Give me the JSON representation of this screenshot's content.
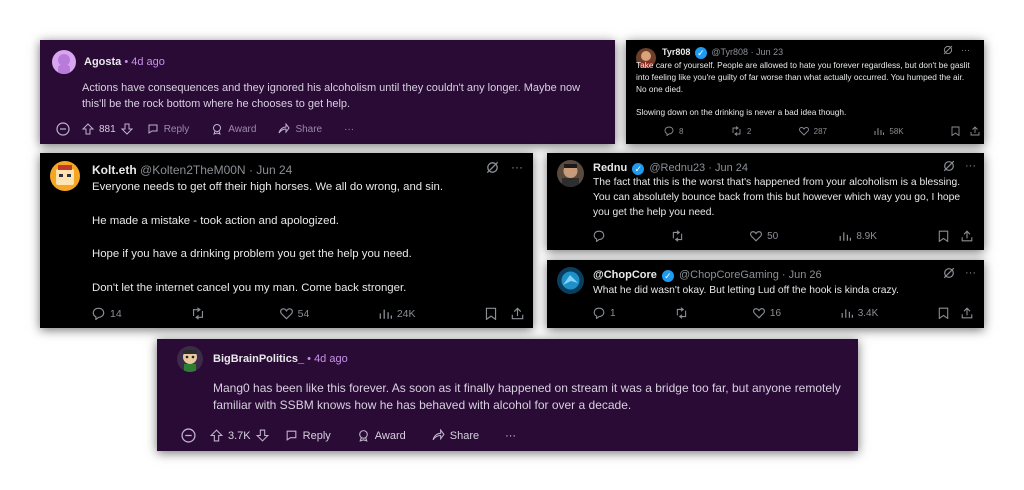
{
  "reddit1": {
    "username": "Agosta",
    "age": "4d ago",
    "text": "Actions have consequences and they ignored his alcoholism until they couldn't any longer. Maybe now this'll be the rock bottom where he chooses to get help.",
    "votes": "881",
    "reply": "Reply",
    "award": "Award",
    "share": "Share",
    "more": "···"
  },
  "tweet1": {
    "name": "Tyr808",
    "handle": "@Tyr808",
    "date": "· Jun 23",
    "text": "Take care of yourself. People are allowed to hate you forever regardless, but don't be gaslit into feeling like you're guilty of far worse than what actually occurred. You humped the air. No one died.\n\nSlowing down on the drinking is never a bad idea though.",
    "replies": "8",
    "retweets": "2",
    "likes": "287",
    "views": "58K"
  },
  "tweet2": {
    "name": "Kolt.eth",
    "handle": "@Kolten2TheM00N",
    "date": "· Jun 24",
    "text": "Everyone needs to get off their high horses. We all do wrong, and sin.\n\nHe made a mistake - took action and apologized.\n\nHope if you have a drinking problem you get the help you need.\n\nDon't let the internet cancel you my man. Come back stronger.",
    "replies": "14",
    "retweets": "",
    "likes": "54",
    "views": "24K"
  },
  "tweet3": {
    "name": "Rednu",
    "handle": "@Rednu23",
    "date": "· Jun 24",
    "text": "The fact that this is the worst that's happened from your alcoholism is a blessing. You can absolutely bounce back from this but however which way you go, I hope you get the help you need.",
    "replies": "",
    "retweets": "",
    "likes": "50",
    "views": "8.9K"
  },
  "tweet4": {
    "name": "@ChopCore",
    "handle": "@ChopCoreGaming",
    "date": "· Jun 26",
    "text": "What he did wasn't okay. But letting Lud off the hook is kinda crazy.",
    "replies": "1",
    "retweets": "",
    "likes": "16",
    "views": "3.4K"
  },
  "reddit2": {
    "username": "BigBrainPolitics_",
    "age": "4d ago",
    "text": "Mang0 has been like this forever. As soon as it finally happened on stream it was a bridge too far, but anyone remotely familiar with SSBM knows how he has behaved with alcohol for over a decade.",
    "votes": "3.7K",
    "reply": "Reply",
    "award": "Award",
    "share": "Share",
    "more": "···"
  },
  "colors": {
    "reddit_bg": "#2a0b36",
    "twitter_bg": "#000000",
    "verified": "#1d9bf0",
    "reddit_age": "#c792ea"
  }
}
